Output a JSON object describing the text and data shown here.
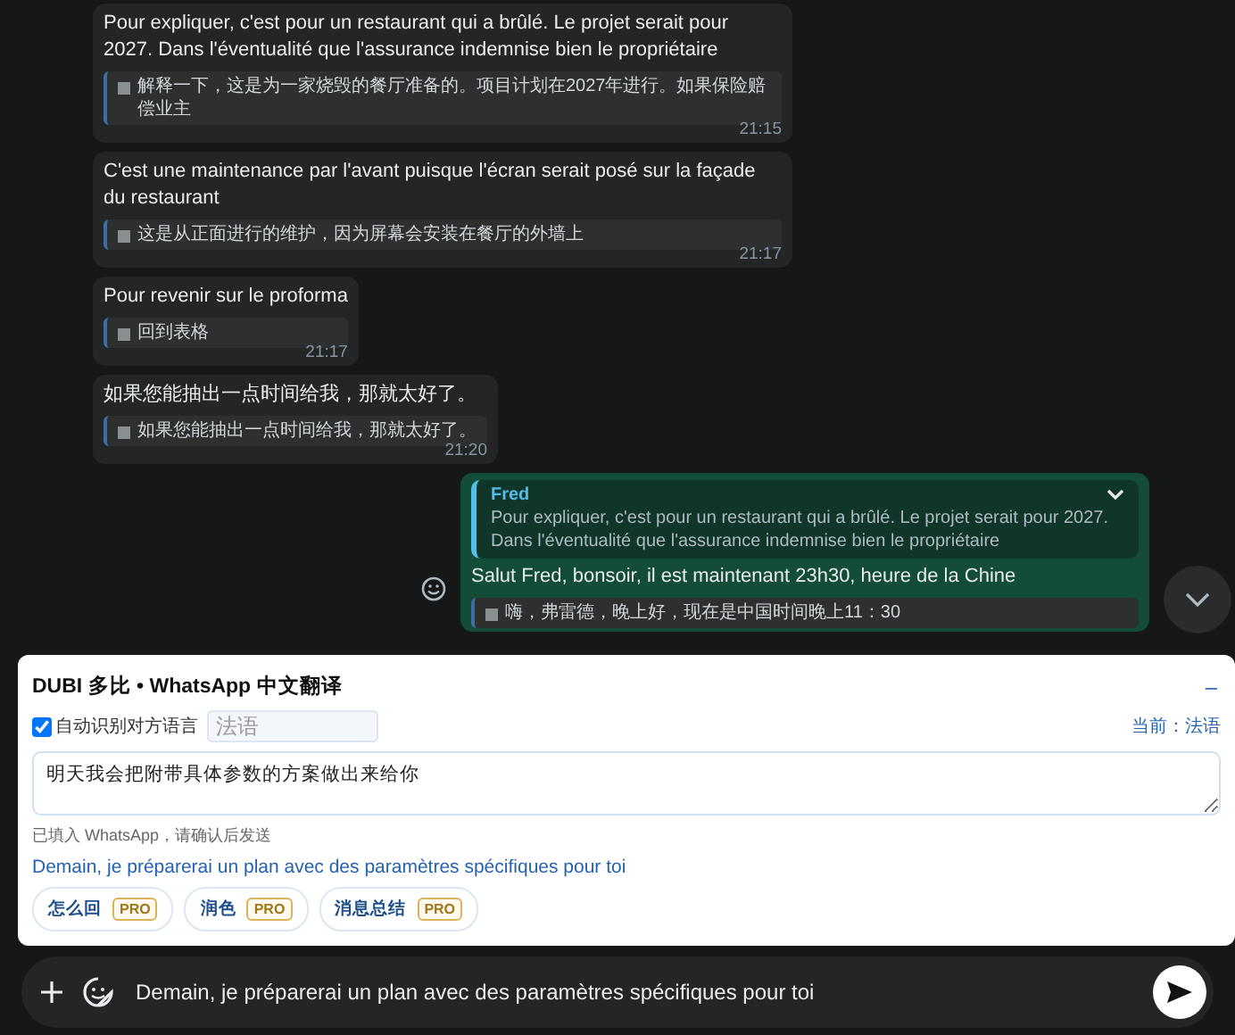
{
  "messages": [
    {
      "kind": "incoming",
      "text": "Pour expliquer, c'est pour un restaurant qui a brûlé. Le projet serait pour 2027. Dans l'éventualité que l'assurance indemnise bien le propriétaire",
      "translation": "解释一下，这是为一家烧毁的餐厅准备的。项目计划在2027年进行。如果保险赔偿业主",
      "time": "21:15"
    },
    {
      "kind": "incoming",
      "text": "C'est une maintenance par l'avant puisque l'écran serait posé sur la façade du restaurant",
      "translation": "这是从正面进行的维护，因为屏幕会安装在餐厅的外墙上",
      "time": "21:17"
    },
    {
      "kind": "incoming",
      "text": "Pour revenir sur le proforma",
      "translation": "回到表格",
      "time": "21:17"
    },
    {
      "kind": "incoming",
      "text": "如果您能抽出一点时间给我，那就太好了。",
      "translation": "如果您能抽出一点时间给我，那就太好了。",
      "time": "21:20"
    },
    {
      "kind": "outgoing",
      "quote": {
        "author": "Fred",
        "text": "Pour expliquer, c'est pour un restaurant qui a brûlé. Le projet serait pour 2027. Dans l'éventualité que l'assurance indemnise bien le propriétaire"
      },
      "text": "Salut Fred, bonsoir, il est maintenant 23h30, heure de la Chine",
      "translation": "嗨，弗雷德，晚上好，现在是中国时间晚上11：30"
    }
  ],
  "panel": {
    "title": "DUBI 多比 • WhatsApp 中文翻译",
    "minimize": "–",
    "auto_detect": {
      "label": "自动识别对方语言",
      "checked": true
    },
    "language_field": {
      "placeholder": "法语"
    },
    "current": "当前：法语",
    "source_text": "明天我会把附带具体参数的方案做出来给你",
    "hint": "已填入 WhatsApp，请确认后发送",
    "result": "Demain, je préparerai un plan avec des paramètres spécifiques pour toi",
    "actions": [
      {
        "label": "怎么回",
        "badge": "PRO"
      },
      {
        "label": "润色",
        "badge": "PRO"
      },
      {
        "label": "消息总结",
        "badge": "PRO"
      }
    ]
  },
  "composer": {
    "value": "Demain, je préparerai un plan avec des paramètres spécifiques pour toi"
  }
}
